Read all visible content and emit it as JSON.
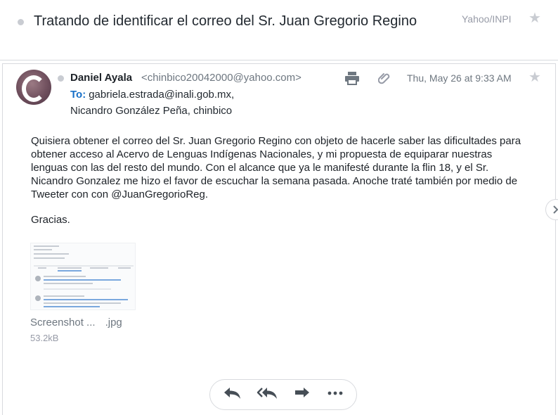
{
  "thread": {
    "subject": "Tratando de identificar el correo del Sr. Juan Gregorio Regino",
    "folder": "Yahoo/INPI"
  },
  "message": {
    "sender_name": "Daniel Ayala",
    "sender_email": "<chinbico20042000@yahoo.com>",
    "to_label": "To:",
    "to_first": "gabriela.estrada@inali.gob.mx,",
    "to_rest": "Nicandro González Peña,  chinbico",
    "date": "Thu, May 26 at 9:33 AM",
    "body": "Quisiera obtener el correo del Sr. Juan Gregorio Regino con objeto de hacerle saber las dificultades para obtener acceso al Acervo de Lenguas Indígenas Nacionales, y mi propuesta de equiparar nuestras lenguas con las del resto del mundo. Con el alcance que ya le manifesté durante la flin 18, y el Sr. Nicandro Gonzalez me hizo el favor de escuchar la semana pasada. Anoche traté también por medio de Tweeter con con @JuanGregorioReg.",
    "closing": "Gracias."
  },
  "attachment": {
    "name": "Screenshot ...",
    "ext": ".jpg",
    "size": "53.2kB"
  },
  "icons": {
    "print": "printer-icon",
    "attach": "paperclip-icon",
    "star": "star-icon",
    "reply": "reply-icon",
    "reply_all": "reply-all-icon",
    "forward": "forward-icon",
    "more": "more-icon",
    "next": "chevron-right-icon"
  },
  "colors": {
    "link": "#1870c8",
    "icon": "#6e7780"
  }
}
